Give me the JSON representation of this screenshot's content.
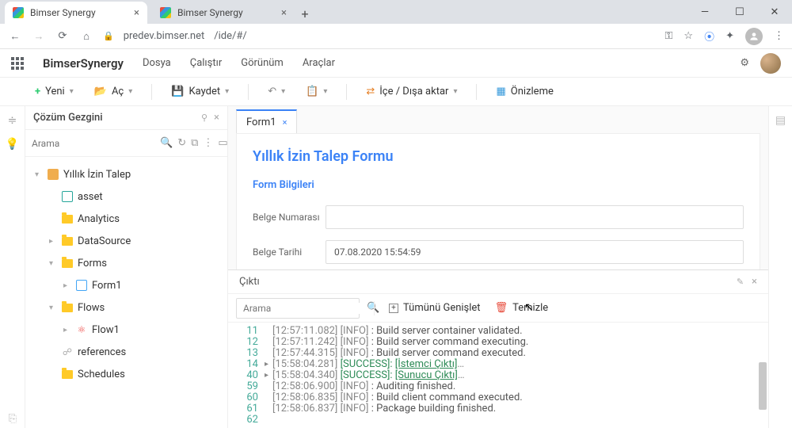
{
  "browser": {
    "tabs": [
      {
        "title": "Bimser Synergy"
      },
      {
        "title": "Bimser Synergy"
      }
    ],
    "url_host": "predev.bimser.net",
    "url_path": "/ide/#/"
  },
  "menubar": {
    "brand": "BimserSynergy",
    "items": [
      "Dosya",
      "Çalıştır",
      "Görünüm",
      "Araçlar"
    ]
  },
  "toolbar": {
    "new": "Yeni",
    "open": "Aç",
    "save": "Kaydet",
    "import_export": "İçe / Dışa aktar",
    "preview": "Önizleme"
  },
  "explorer": {
    "title": "Çözüm Gezgini",
    "search_placeholder": "Arama",
    "tree": {
      "project": "Yıllık İzin Talep",
      "asset": "asset",
      "analytics": "Analytics",
      "datasource": "DataSource",
      "forms": "Forms",
      "form1": "Form1",
      "flows": "Flows",
      "flow1": "Flow1",
      "references": "references",
      "schedules": "Schedules"
    }
  },
  "tab": {
    "label": "Form1"
  },
  "form": {
    "title": "Yıllık İzin Talep Formu",
    "section": "Form Bilgileri",
    "doc_no_label": "Belge Numarası",
    "doc_no_value": "",
    "doc_date_label": "Belge Tarihi",
    "doc_date_value": "07.08.2020 15:54:59"
  },
  "output": {
    "title": "Çıktı",
    "search_placeholder": "Arama",
    "expand_all": "Tümünü Genişlet",
    "clear": "Temizle",
    "lines": [
      {
        "n": "11",
        "ts": "[12:57:11.082]",
        "lvl": "[INFO]",
        "sep": ":",
        "msg": "Build server container validated."
      },
      {
        "n": "12",
        "ts": "[12:57:11.242]",
        "lvl": "[INFO]",
        "sep": ":",
        "msg": "Build server command executing."
      },
      {
        "n": "13",
        "ts": "[12:57:44.315]",
        "lvl": "[INFO]",
        "sep": ":",
        "msg": "Build server command executed."
      },
      {
        "n": "14",
        "fold": true,
        "ts": "[15:58:04.281]",
        "lvl": "[SUCCESS]",
        "sep": ":",
        "msg": "[İstemci Çıktı]",
        "dots": "…",
        "success": true
      },
      {
        "n": "40",
        "fold": true,
        "ts": "[15:58:04.340]",
        "lvl": "[SUCCESS]",
        "sep": ":",
        "msg": "[Sunucu Çıktı]",
        "dots": "…",
        "success": true
      },
      {
        "n": "59",
        "ts": "[12:58:06.900]",
        "lvl": "[INFO]",
        "sep": ":",
        "msg": "Auditing finished."
      },
      {
        "n": "60",
        "ts": "[12:58:06.835]",
        "lvl": "[INFO]",
        "sep": ":",
        "msg": "Build client command executed."
      },
      {
        "n": "61",
        "ts": "[12:58:06.837]",
        "lvl": "[INFO]",
        "sep": ":",
        "msg": "Package building finished."
      },
      {
        "n": "62",
        "ts": "",
        "lvl": "",
        "sep": "",
        "msg": ""
      }
    ]
  }
}
